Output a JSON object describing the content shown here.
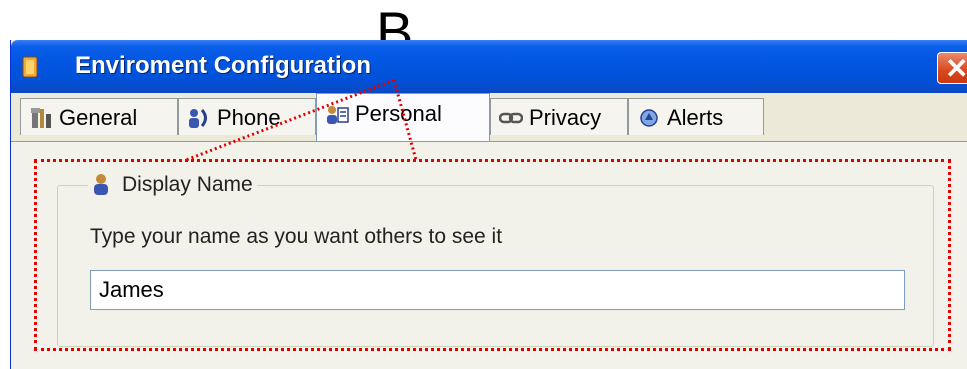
{
  "annotation": {
    "letter": "B"
  },
  "window": {
    "title": "Enviroment Configuration",
    "icons": {
      "app": "app-icon",
      "close": "close-icon"
    }
  },
  "tabs": [
    {
      "label": "General",
      "icon": "tools-icon",
      "active": false
    },
    {
      "label": "Phone",
      "icon": "phone-contacts-icon",
      "active": false
    },
    {
      "label": "Personal",
      "icon": "personal-card-icon",
      "active": true
    },
    {
      "label": "Privacy",
      "icon": "link-chain-icon",
      "active": false
    },
    {
      "label": "Alerts",
      "icon": "alerts-icon",
      "active": false
    }
  ],
  "display_name": {
    "legend": "Display Name",
    "legend_icon": "user-icon",
    "instruction": "Type your name as you want others to see it",
    "value": "James",
    "placeholder": ""
  },
  "colors": {
    "titlebar": "#0151d8",
    "close": "#d9471e",
    "callout": "#e00000",
    "panel": "#ece9d8"
  }
}
